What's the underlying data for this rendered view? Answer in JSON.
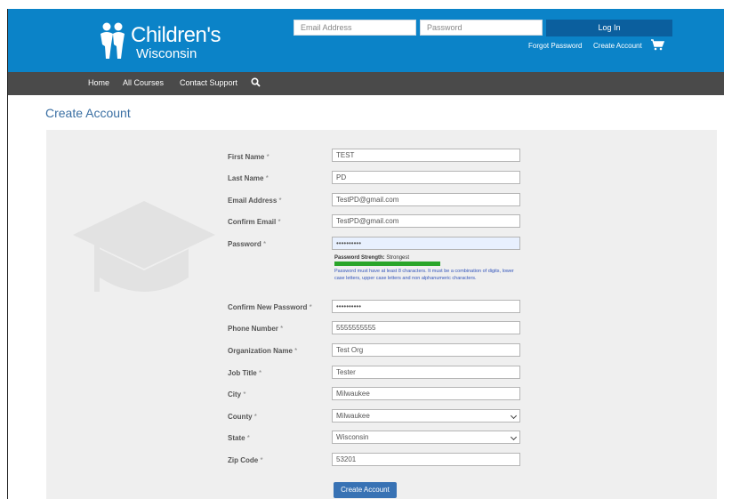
{
  "brand": {
    "logo_line1": "Children's",
    "logo_line2": "Wisconsin"
  },
  "login": {
    "email_placeholder": "Email Address",
    "password_placeholder": "Password",
    "login_label": "Log In",
    "forgot_label": "Forgot Password",
    "create_label": "Create Account"
  },
  "nav": {
    "items": [
      "Home",
      "All Courses",
      "Contact Support"
    ]
  },
  "page": {
    "title": "Create Account"
  },
  "form": {
    "first_name": {
      "label": "First Name",
      "value": "TEST"
    },
    "last_name": {
      "label": "Last Name",
      "value": "PD"
    },
    "email": {
      "label": "Email Address",
      "value": "TestPD@gmail.com"
    },
    "confirm_email": {
      "label": "Confirm Email",
      "value": "TestPD@gmail.com"
    },
    "password": {
      "label": "Password",
      "value": "••••••••••"
    },
    "strength_prefix": "Password Strength:",
    "strength_value": "Strongest",
    "strength_level": 0.56,
    "password_help": "Password must have at least 8 characters. It must be a combination of digits, lower case letters, upper case letters and non alphanumeric characters.",
    "confirm_password": {
      "label": "Confirm New Password",
      "value": "••••••••••"
    },
    "phone": {
      "label": "Phone Number",
      "value": "5555555555"
    },
    "organization": {
      "label": "Organization Name",
      "value": "Test Org"
    },
    "job_title": {
      "label": "Job Title",
      "value": "Tester"
    },
    "city": {
      "label": "City",
      "value": "Milwaukee"
    },
    "county": {
      "label": "County",
      "value": "Milwaukee"
    },
    "state": {
      "label": "State",
      "value": "Wisconsin"
    },
    "zip": {
      "label": "Zip Code",
      "value": "53201"
    },
    "required_mark": "*",
    "submit_label": "Create Account"
  },
  "colors": {
    "header_blue": "#0b83c8",
    "nav_gray": "#4a4a4a",
    "button_blue": "#3872b4",
    "strength_green": "#2aa52a"
  }
}
